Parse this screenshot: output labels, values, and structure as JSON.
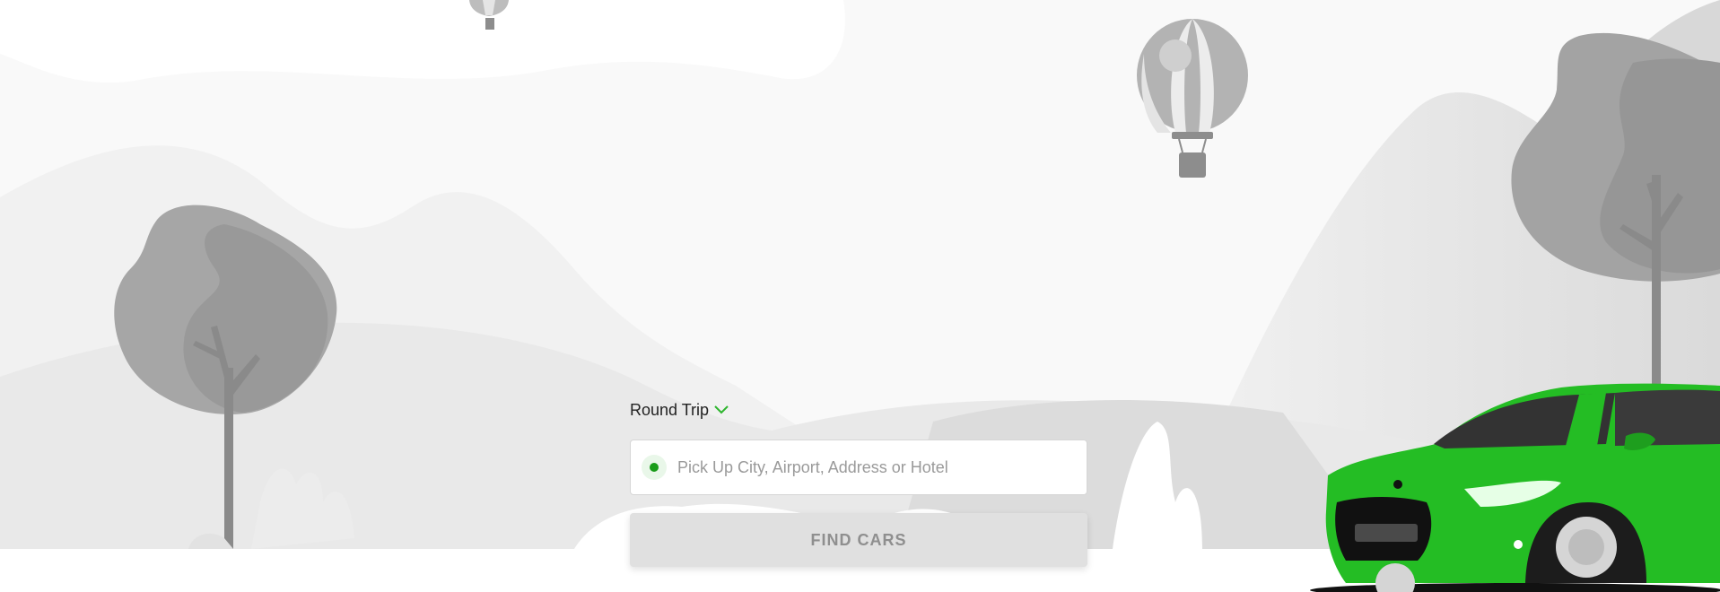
{
  "trip": {
    "label": "Round Trip",
    "accent": "#2db52d"
  },
  "pickup": {
    "placeholder": "Pick Up City, Airport, Address or Hotel",
    "value": ""
  },
  "actions": {
    "find_label": "FIND CARS"
  },
  "colors": {
    "car": "#24bd24",
    "scenery": "#9a9a9a",
    "button_bg": "#e0e0e0"
  }
}
